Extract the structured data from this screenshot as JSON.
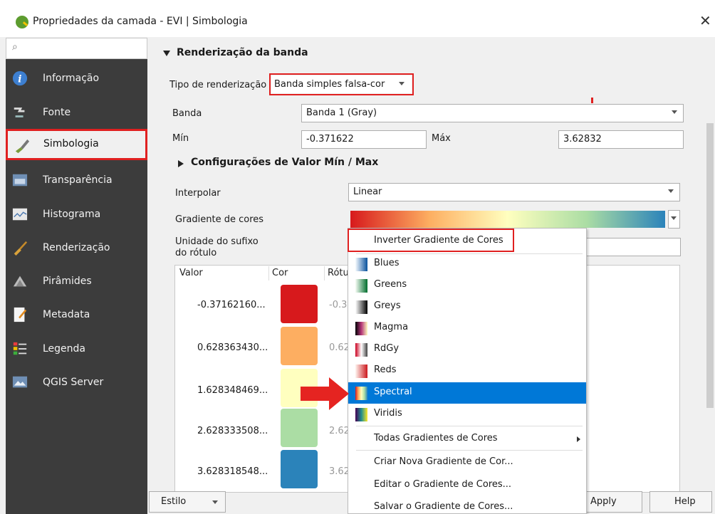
{
  "window": {
    "title": "Propriedades da camada - EVI | Simbologia",
    "close_glyph": "✕"
  },
  "search": {
    "icon": "⌕"
  },
  "sidebar": {
    "items": [
      {
        "label": "Informação",
        "icon": "info-icon"
      },
      {
        "label": "Fonte",
        "icon": "source-icon"
      },
      {
        "label": "Simbologia",
        "icon": "brush-icon",
        "selected": true
      },
      {
        "label": "Transparência",
        "icon": "transparency-icon"
      },
      {
        "label": "Histograma",
        "icon": "histogram-icon"
      },
      {
        "label": "Renderização",
        "icon": "rendering-icon"
      },
      {
        "label": "Pirâmides",
        "icon": "pyramids-icon"
      },
      {
        "label": "Metadata",
        "icon": "metadata-icon"
      },
      {
        "label": "Legenda",
        "icon": "legend-icon"
      },
      {
        "label": "QGIS Server",
        "icon": "server-icon"
      }
    ]
  },
  "band_rendering": {
    "section_title": "Renderização da banda",
    "render_type_label": "Tipo de renderização",
    "render_type_value": "Banda simples falsa-cor",
    "band_label": "Banda",
    "band_value": "Banda 1 (Gray)",
    "min_label": "Mín",
    "min_value": "-0.371622",
    "max_label": "Máx",
    "max_value": "3.62832",
    "minmax_section": "Configurações de Valor Mín / Max",
    "interpolate_label": "Interpolar",
    "interpolate_value": "Linear",
    "gradient_label": "Gradiente de cores",
    "suffix_label_1": "Unidade do sufixo",
    "suffix_label_2": "do rótulo"
  },
  "table": {
    "headers": [
      "Valor",
      "Cor",
      "Rótu"
    ],
    "rows": [
      {
        "value": "-0.37162160...",
        "color": "#d7191c",
        "label": "-0.3"
      },
      {
        "value": "0.628363430...",
        "color": "#fdae61",
        "label": "0.62"
      },
      {
        "value": "1.628348469...",
        "color": "#ffffbf",
        "label": ""
      },
      {
        "value": "2.628333508...",
        "color": "#abdda4",
        "label": "2.62"
      },
      {
        "value": "3.628318548...",
        "color": "#2b83ba",
        "label": "3.62"
      }
    ]
  },
  "menu": {
    "invert": "Inverter Gradiente de Cores",
    "ramps": [
      {
        "label": "Blues",
        "icon": "blues-ramp-icon"
      },
      {
        "label": "Greens",
        "icon": "greens-ramp-icon"
      },
      {
        "label": "Greys",
        "icon": "greys-ramp-icon"
      },
      {
        "label": "Magma",
        "icon": "magma-ramp-icon"
      },
      {
        "label": "RdGy",
        "icon": "rdgy-ramp-icon"
      },
      {
        "label": "Reds",
        "icon": "reds-ramp-icon"
      },
      {
        "label": "Spectral",
        "icon": "spectral-ramp-icon",
        "selected": true
      },
      {
        "label": "Viridis",
        "icon": "viridis-ramp-icon"
      }
    ],
    "all_ramps": "Todas Gradientes de Cores",
    "create": "Criar Nova Gradiente de Cor...",
    "edit": "Editar o Gradiente de Cores...",
    "save": "Salvar o Gradiente de Cores..."
  },
  "footer": {
    "style_label": "Estilo",
    "apply_label": "Apply",
    "help_label": "Help"
  },
  "colors": {
    "highlight": "#e02020",
    "selection": "#0078d7",
    "sidebar": "#3c3c3c"
  }
}
